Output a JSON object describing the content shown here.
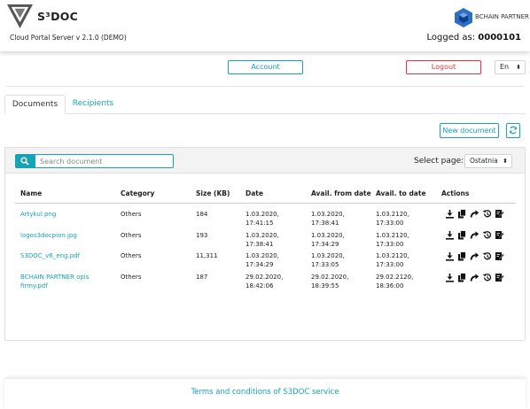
{
  "header": {
    "app_name": "S³DOC",
    "version": "Cloud Portal Server v 2.1.0 (DEMO)",
    "partner_name": "BCHAIN PARTNER",
    "logged_label": "Logged as:",
    "logged_user": "0000101"
  },
  "nav": {
    "account_label": "Account",
    "logout_label": "Logout",
    "language": "En"
  },
  "tabs": [
    {
      "label": "Documents",
      "active": true
    },
    {
      "label": "Recipients",
      "active": false
    }
  ],
  "toolbar": {
    "new_document_label": "New document",
    "refresh_icon": "refresh-icon"
  },
  "search": {
    "placeholder": "Search document",
    "value": ""
  },
  "pagination": {
    "label": "Select page:",
    "selected": "Ostatnia"
  },
  "table": {
    "columns": [
      "Name",
      "Category",
      "Size (KB)",
      "Date",
      "Avail. from date",
      "Avail. to date",
      "Actions"
    ],
    "rows": [
      {
        "name": "Artykul.png",
        "category": "Others",
        "size": "184",
        "date": "1.03.2020, 17:41:15",
        "from": "1.03.2020, 17:38:41",
        "to": "1.03.2120, 17:33:00"
      },
      {
        "name": "logos3docpion.jpg",
        "category": "Others",
        "size": "193",
        "date": "1.03.2020, 17:38:41",
        "from": "1.03.2020, 17:34:29",
        "to": "1.03.2120, 17:33:00"
      },
      {
        "name": "S3DOC_v6_eng.pdf",
        "category": "Others",
        "size": "11,311",
        "date": "1.03.2020, 17:34:29",
        "from": "1.03.2020, 17:33:05",
        "to": "1.03.2120, 17:33:00"
      },
      {
        "name": "BCHAIN PARTNER opis firmy.pdf",
        "category": "Others",
        "size": "187",
        "date": "29.02.2020, 18:42:06",
        "from": "29.02.2020, 18:39:55",
        "to": "29.02.2120, 18:36:00"
      }
    ],
    "action_icons": [
      "download-icon",
      "copy-icon",
      "share-icon",
      "history-icon",
      "sign-icon"
    ]
  },
  "footer": {
    "terms_label": "Terms and conditions of S3DOC service"
  },
  "colors": {
    "accent": "#17a2b8",
    "danger": "#dc3545",
    "text": "#212529"
  }
}
